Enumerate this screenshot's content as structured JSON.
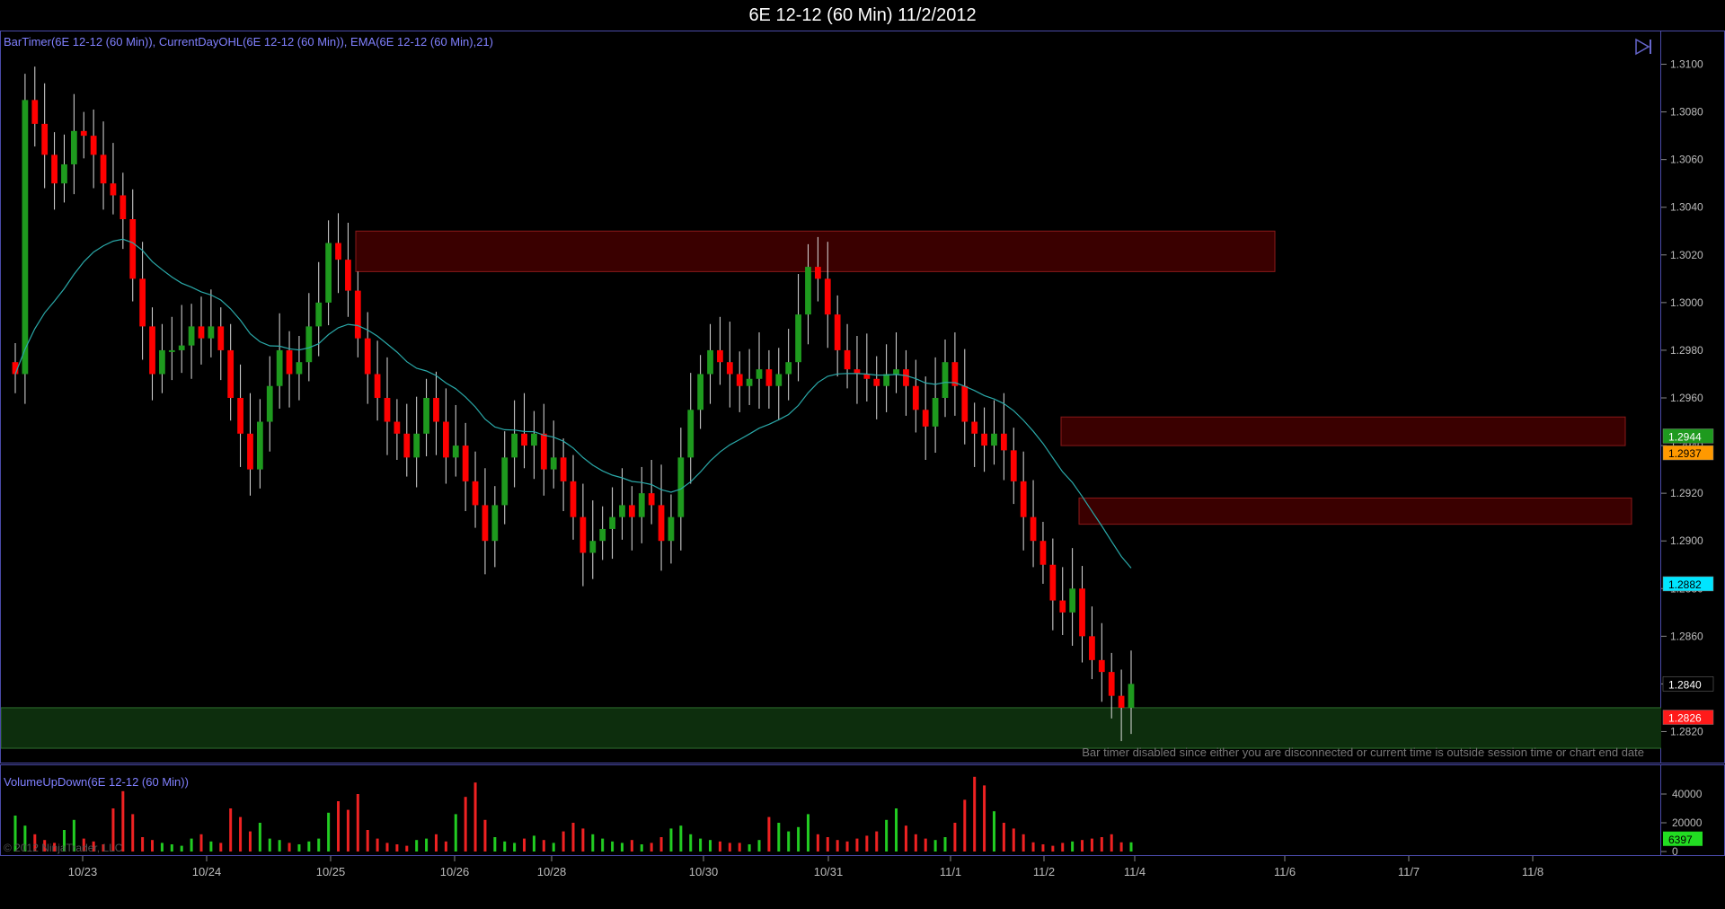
{
  "window": {
    "title": "6E 12-12 (60 Min)  11/2/2012"
  },
  "price_panel": {
    "indicators_label": "BarTimer(6E 12-12 (60 Min)), CurrentDayOHL(6E 12-12 (60 Min)), EMA(6E 12-12 (60 Min),21)",
    "bar_timer_notice": "Bar timer disabled since either you are disconnected or current time is outside session time or chart end date",
    "nav_icon": "skip-to-end-icon"
  },
  "volume_panel": {
    "label": "VolumeUpDown(6E 12-12 (60 Min))",
    "copyright": "© 2012 NinjaTrader, LLC"
  },
  "colors": {
    "up": "#1e9a1e",
    "down": "#ff0000",
    "ema": "#2aa9a9",
    "zone_red": "#3a0000",
    "zone_green": "#0d2e0d",
    "border": "#4a4aa8"
  },
  "chart_data": [
    {
      "type": "candlestick",
      "title": "6E 12-12 (60 Min)  11/2/2012",
      "ylim": [
        1.281,
        1.311
      ],
      "y_ticks": [
        "1.3100",
        "1.3080",
        "1.3060",
        "1.3040",
        "1.3020",
        "1.3000",
        "1.2980",
        "1.2960",
        "1.2940",
        "1.2920",
        "1.2900",
        "1.2880",
        "1.2860",
        "1.2840",
        "1.2820"
      ],
      "x_tick_labels": [
        "10/23",
        "10/24",
        "10/25",
        "10/26",
        "10/28",
        "10/30",
        "10/31",
        "11/1",
        "11/2",
        "11/4",
        "11/6",
        "11/7",
        "11/8"
      ],
      "price_markers": [
        {
          "label": "1.2944",
          "value": 1.2944,
          "color": "#1e9a1e",
          "text_color": "#ffffff"
        },
        {
          "label": "1.2937",
          "value": 1.2937,
          "color": "#ff9900",
          "text_color": "#000000"
        },
        {
          "label": "1.2882",
          "value": 1.2882,
          "color": "#00e5ff",
          "text_color": "#000000"
        },
        {
          "label": "1.2840",
          "value": 1.284,
          "color": "#000000",
          "text_color": "#ffffff"
        },
        {
          "label": "1.2826",
          "value": 1.2826,
          "color": "#ff1a1a",
          "text_color": "#ffffff"
        }
      ],
      "zones": [
        {
          "kind": "supply",
          "from": 1.3013,
          "to": 1.303
        },
        {
          "kind": "supply",
          "from": 1.294,
          "to": 1.2952
        },
        {
          "kind": "supply",
          "from": 1.2907,
          "to": 1.2918
        },
        {
          "kind": "demand",
          "from": 1.2813,
          "to": 1.283
        }
      ],
      "closes": [
        1.297,
        1.3085,
        1.3075,
        1.3062,
        1.305,
        1.3058,
        1.3072,
        1.307,
        1.3062,
        1.305,
        1.3045,
        1.3035,
        1.301,
        1.299,
        1.297,
        1.298,
        1.298,
        1.2982,
        1.299,
        1.2985,
        1.299,
        1.298,
        1.296,
        1.2945,
        1.293,
        1.295,
        1.2965,
        1.298,
        1.297,
        1.2975,
        1.299,
        1.3,
        1.3025,
        1.3018,
        1.3005,
        1.2985,
        1.297,
        1.296,
        1.295,
        1.2945,
        1.2935,
        1.2945,
        1.296,
        1.295,
        1.2935,
        1.294,
        1.2925,
        1.2915,
        1.29,
        1.2915,
        1.2935,
        1.2945,
        1.294,
        1.2945,
        1.293,
        1.2935,
        1.2925,
        1.291,
        1.2895,
        1.29,
        1.2905,
        1.291,
        1.2915,
        1.291,
        1.292,
        1.2915,
        1.29,
        1.291,
        1.2935,
        1.2955,
        1.297,
        1.298,
        1.2975,
        1.297,
        1.2965,
        1.2968,
        1.2972,
        1.2965,
        1.297,
        1.2975,
        1.2995,
        1.3015,
        1.301,
        1.2995,
        1.298,
        1.2972,
        1.297,
        1.2968,
        1.2965,
        1.297,
        1.2972,
        1.2965,
        1.2955,
        1.2948,
        1.296,
        1.2975,
        1.2965,
        1.295,
        1.2945,
        1.294,
        1.2945,
        1.2938,
        1.2925,
        1.291,
        1.29,
        1.289,
        1.2875,
        1.287,
        1.288,
        1.286,
        1.285,
        1.2845,
        1.2835,
        1.283,
        1.284
      ],
      "ema_period": 21,
      "volume": {
        "type": "bar",
        "ylim": [
          0,
          55000
        ],
        "y_ticks": [
          "40000",
          "20000",
          "0"
        ],
        "last_marker": {
          "label": "6397",
          "value": 6397
        },
        "values": [
          25000,
          18000,
          12000,
          8000,
          6000,
          15000,
          22000,
          9000,
          7000,
          5000,
          30000,
          42000,
          26000,
          10000,
          8000,
          6000,
          5000,
          4000,
          9000,
          12000,
          7000,
          6000,
          30000,
          24000,
          14000,
          20000,
          9000,
          8000,
          6000,
          5000,
          7000,
          9000,
          27000,
          35000,
          29000,
          40000,
          15000,
          9000,
          6000,
          5000,
          4000,
          8000,
          9000,
          12000,
          7000,
          26000,
          38000,
          48000,
          22000,
          10000,
          7000,
          6000,
          9000,
          11000,
          8000,
          6000,
          14000,
          20000,
          16000,
          12000,
          9000,
          7000,
          6000,
          8000,
          5000,
          6000,
          10000,
          16000,
          18000,
          12000,
          9000,
          8000,
          7000,
          6000,
          6000,
          5000,
          8000,
          24000,
          20000,
          14000,
          17000,
          26000,
          12000,
          10000,
          8000,
          7000,
          9000,
          11000,
          14000,
          22000,
          30000,
          18000,
          12000,
          9000,
          8000,
          10000,
          20000,
          36000,
          52000,
          46000,
          28000,
          20000,
          16000,
          12000,
          6397,
          5000,
          4000,
          6000,
          7000,
          8000,
          9000,
          10000,
          12000,
          6397,
          6397
        ]
      }
    }
  ]
}
